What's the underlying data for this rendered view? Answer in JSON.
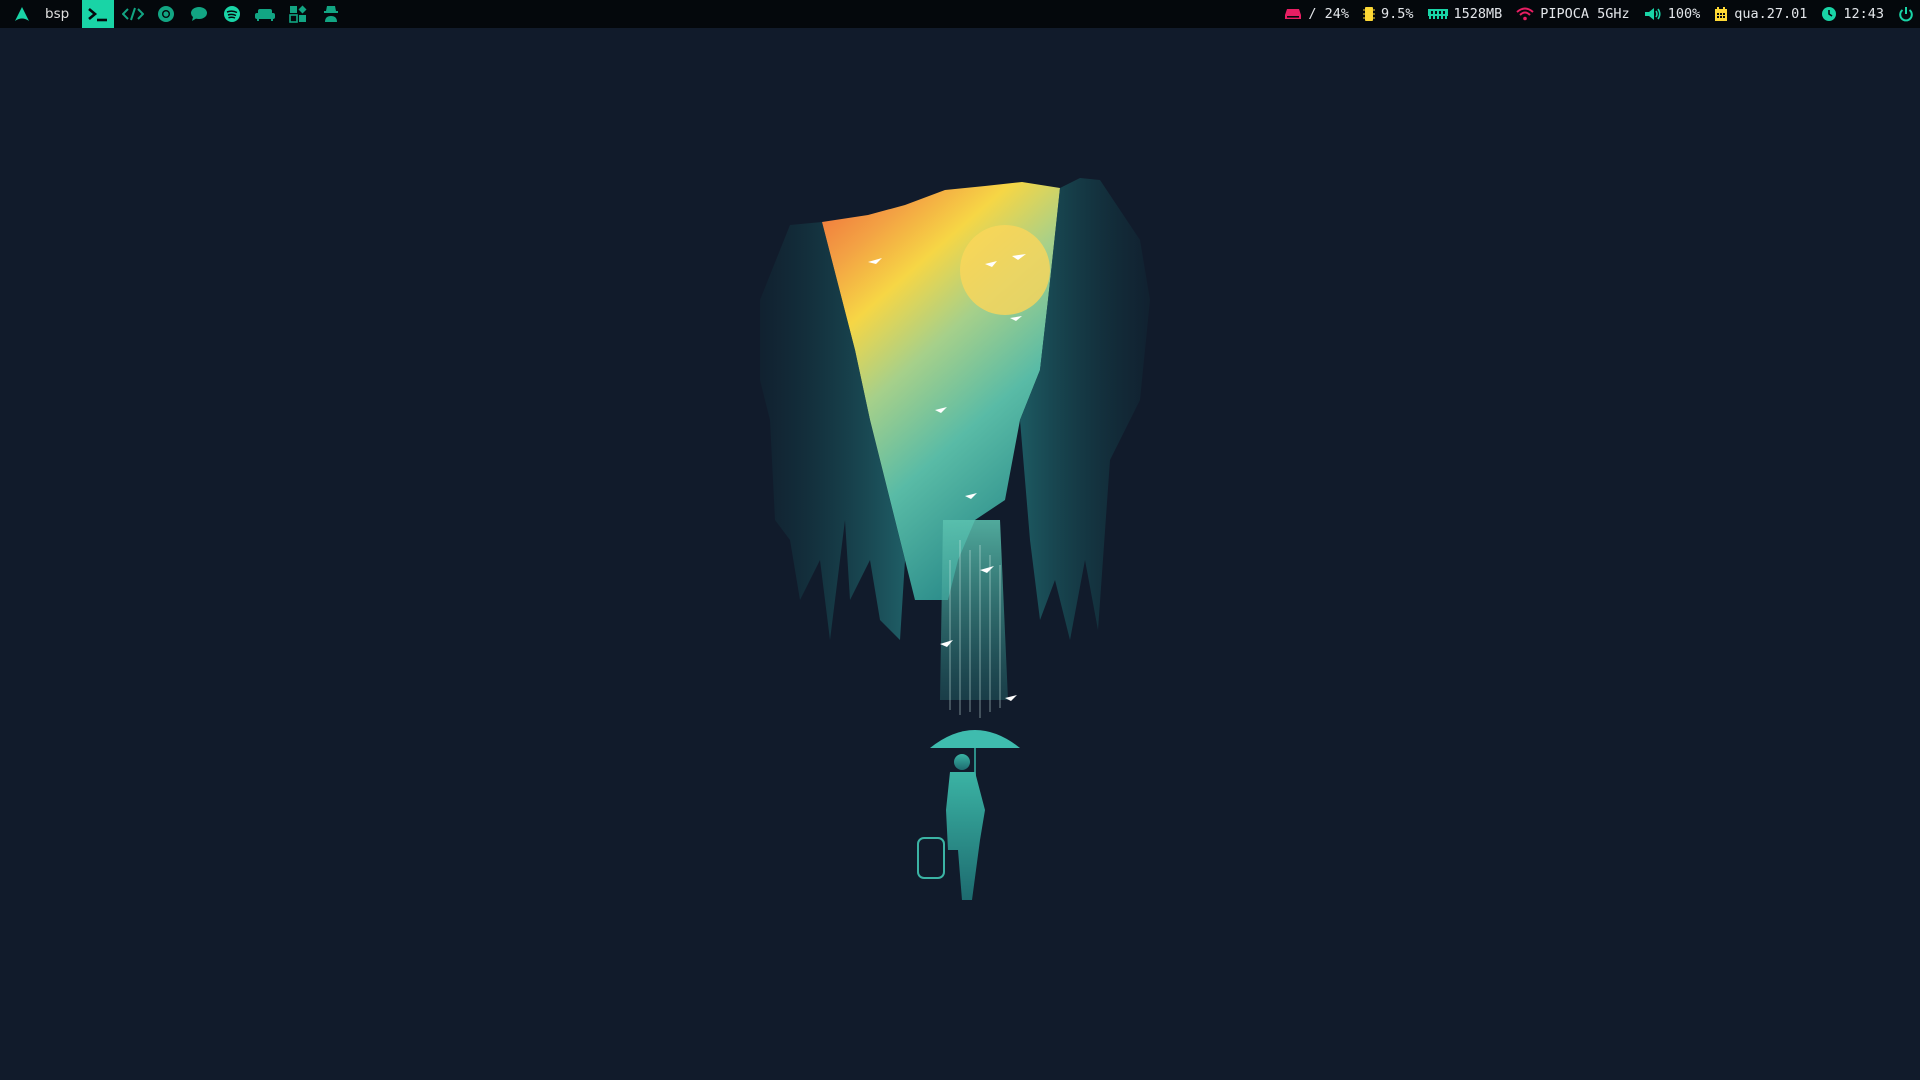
{
  "topbar": {
    "launcher_icon": "arch-logo-icon",
    "layout": "bsp",
    "workspaces": [
      {
        "icon": "terminal-icon",
        "active": true
      },
      {
        "icon": "code-icon",
        "active": false
      },
      {
        "icon": "chrome-icon",
        "active": false
      },
      {
        "icon": "chat-icon",
        "active": false
      },
      {
        "icon": "spotify-icon",
        "active": false
      },
      {
        "icon": "sofa-icon",
        "active": false
      },
      {
        "icon": "apps-icon",
        "active": false
      },
      {
        "icon": "incognito-icon",
        "active": false
      }
    ],
    "disk": {
      "icon": "disk-icon",
      "text": "/ 24%"
    },
    "cpu": {
      "icon": "cpu-icon",
      "text": "9.5%"
    },
    "memory": {
      "icon": "memory-icon",
      "text": "1528MB"
    },
    "wifi": {
      "icon": "wifi-icon",
      "text": "PIPOCA 5GHz"
    },
    "volume": {
      "icon": "volume-icon",
      "text": "100%"
    },
    "date": {
      "icon": "calendar-icon",
      "text": "qua.27.01"
    },
    "time": {
      "icon": "clock-icon",
      "text": "12:43"
    },
    "power_icon": "power-icon",
    "colors": {
      "bar_bg": "#04080c",
      "accent": "#19d4a6",
      "disk": "#e91e63",
      "cpu": "#fdd835",
      "memory": "#19d4a6",
      "wifi": "#e91e63",
      "volume": "#19d4a6",
      "date": "#fdd835",
      "time": "#19d4a6",
      "power": "#19d4a6"
    }
  },
  "desktop": {
    "background": "#111b2b",
    "wallpaper": "city-street-umbrella-illustration"
  }
}
